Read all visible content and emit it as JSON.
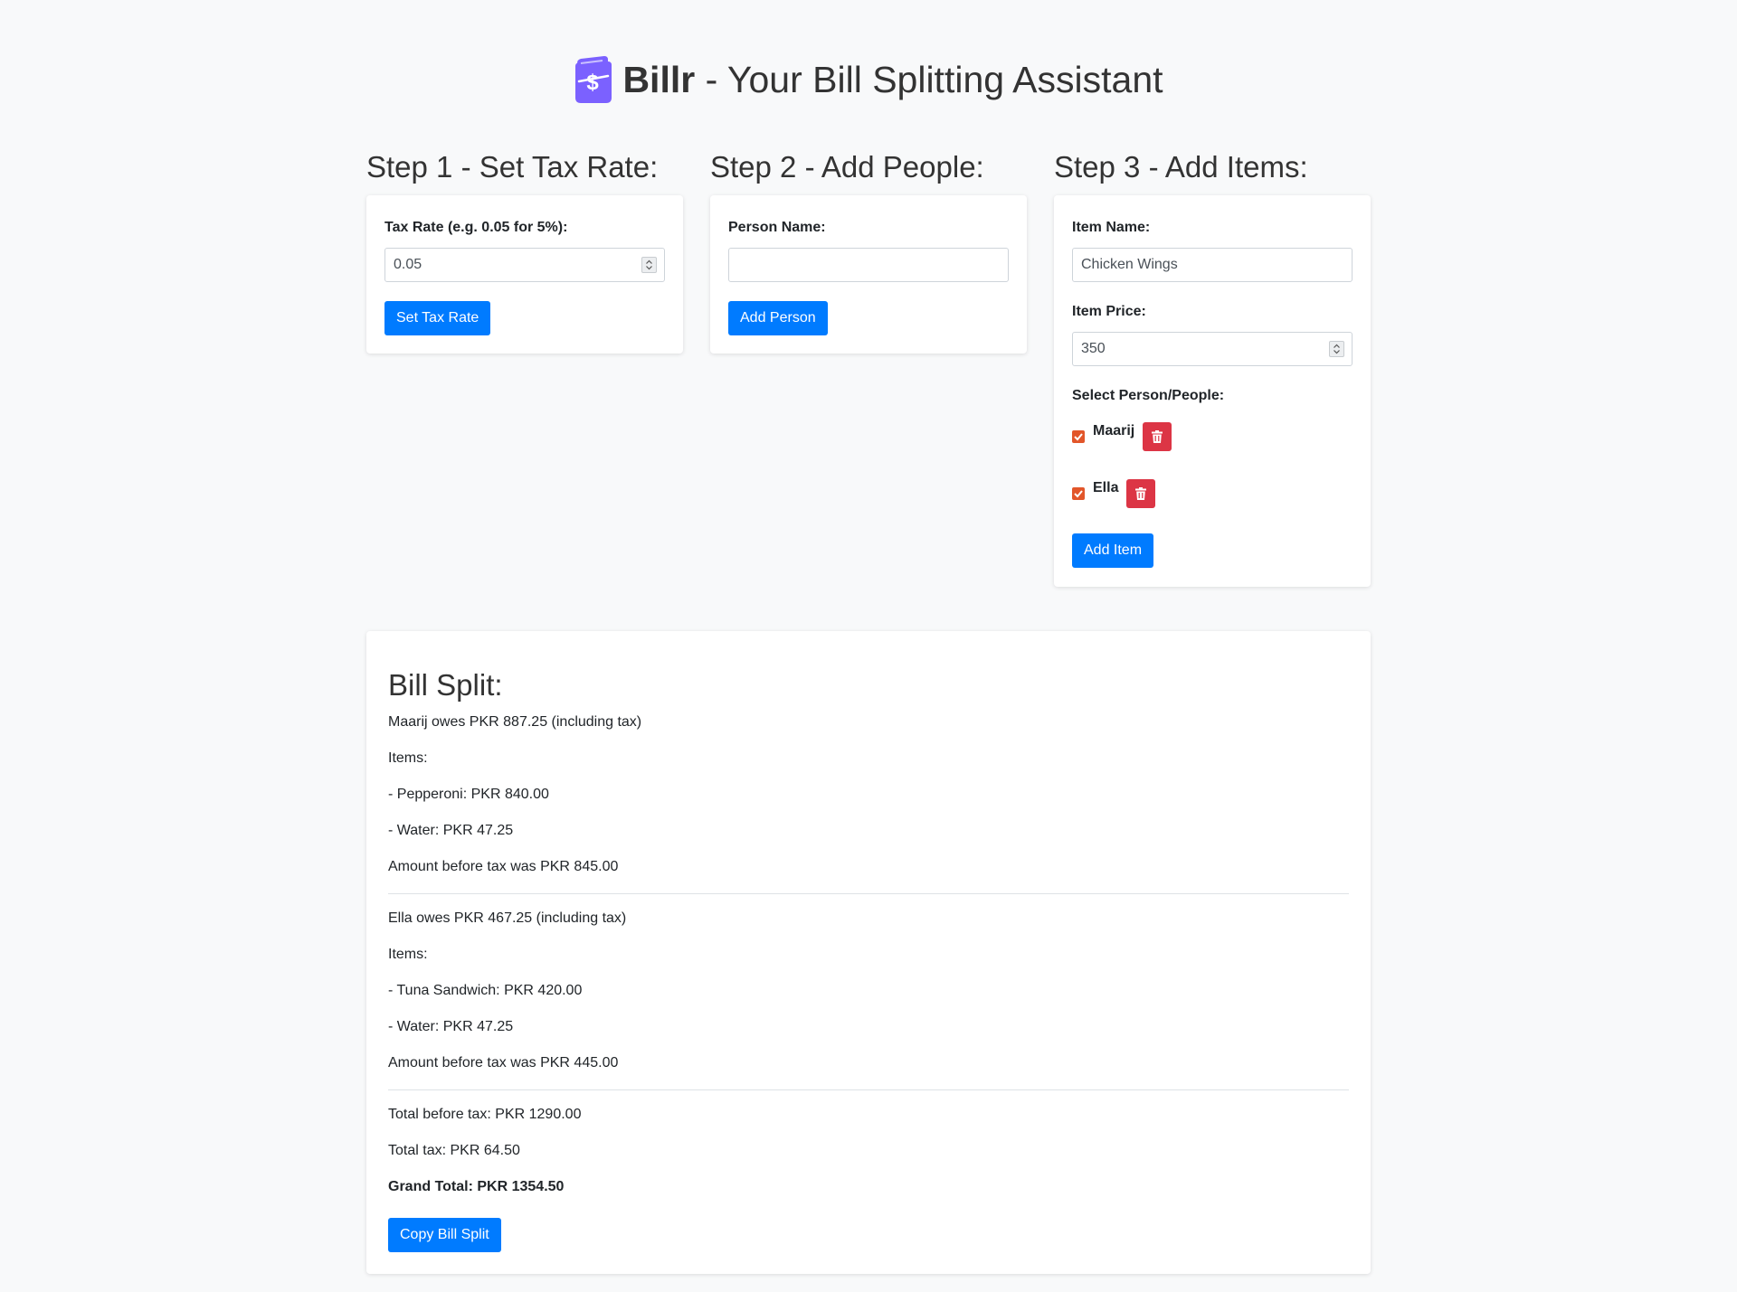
{
  "header": {
    "logo_icon": "wallet-cash-icon",
    "brand": "Billr",
    "tagline": " - Your Bill Splitting Assistant",
    "logo_color": "#7b61ff"
  },
  "step1": {
    "title": "Step 1 - Set Tax Rate:",
    "label": "Tax Rate (e.g. 0.05 for 5%):",
    "value": "0.05",
    "button": "Set Tax Rate"
  },
  "step2": {
    "title": "Step 2 - Add People:",
    "label": "Person Name:",
    "value": "",
    "button": "Add Person"
  },
  "step3": {
    "title": "Step 3 - Add Items:",
    "item_name_label": "Item Name:",
    "item_name_value": "Chicken Wings",
    "item_price_label": "Item Price:",
    "item_price_value": "350",
    "select_label": "Select Person/People:",
    "people": [
      {
        "name": "Maarij",
        "checked": true
      },
      {
        "name": "Ella",
        "checked": true
      }
    ],
    "delete_icon": "trash-icon",
    "button": "Add Item"
  },
  "bill": {
    "title": "Bill Split:",
    "people": [
      {
        "owes": "Maarij owes PKR 887.25 (including tax)",
        "items_label": "Items:",
        "items": [
          "- Pepperoni: PKR 840.00",
          "- Water: PKR 47.25"
        ],
        "before_tax": "Amount before tax was PKR 845.00"
      },
      {
        "owes": "Ella owes PKR 467.25 (including tax)",
        "items_label": "Items:",
        "items": [
          "- Tuna Sandwich: PKR 420.00",
          "- Water: PKR 47.25"
        ],
        "before_tax": "Amount before tax was PKR 445.00"
      }
    ],
    "total_before_tax": "Total before tax: PKR 1290.00",
    "total_tax": "Total tax: PKR 64.50",
    "grand_total": "Grand Total: PKR 1354.50",
    "copy_button": "Copy Bill Split"
  },
  "colors": {
    "primary": "#007bff",
    "danger": "#dc3545",
    "checkbox": "#e2562a",
    "background": "#f8f9fa"
  }
}
